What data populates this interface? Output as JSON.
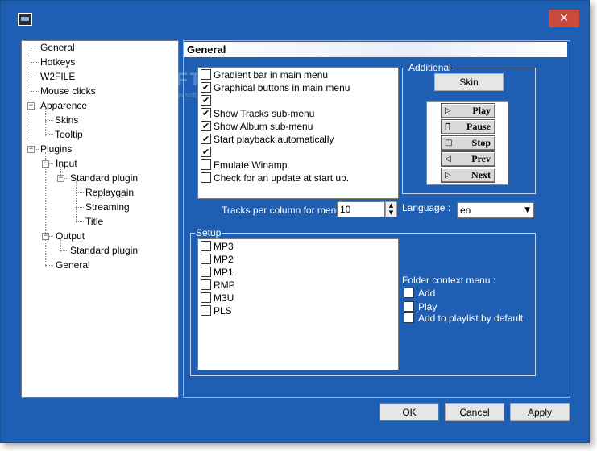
{
  "window": {
    "close_glyph": "✕"
  },
  "tree": {
    "items": [
      {
        "label": "General"
      },
      {
        "label": "Hotkeys"
      },
      {
        "label": "W2FILE"
      },
      {
        "label": "Mouse clicks"
      },
      {
        "label": "Apparence"
      },
      {
        "label": "Skins"
      },
      {
        "label": "Tooltip"
      },
      {
        "label": "Plugins"
      },
      {
        "label": "Input"
      },
      {
        "label": "Standard plugin"
      },
      {
        "label": "Replaygain"
      },
      {
        "label": "Streaming"
      },
      {
        "label": "Title"
      },
      {
        "label": "Output"
      },
      {
        "label": "Standard plugin"
      },
      {
        "label": "General"
      }
    ],
    "expander_glyph": "−"
  },
  "panel": {
    "title": "General"
  },
  "options": [
    {
      "label": "Gradient bar in main menu",
      "checked": false
    },
    {
      "label": "Graphical buttons in main menu",
      "checked": true
    },
    {
      "label": "",
      "checked": true
    },
    {
      "label": "Show Tracks sub-menu",
      "checked": true
    },
    {
      "label": "Show Album sub-menu",
      "checked": true
    },
    {
      "label": "Start playback automatically",
      "checked": true
    },
    {
      "label": "",
      "checked": true
    },
    {
      "label": "Emulate Winamp",
      "checked": false
    },
    {
      "label": "Check for an update at start up.",
      "checked": false
    }
  ],
  "check_glyph": "✔",
  "additional": {
    "group_label": "Additional",
    "skin_button": "Skin",
    "skin_preview": [
      {
        "label": "Play",
        "icon": "play-icon",
        "symbol": "▷"
      },
      {
        "label": "Pause",
        "icon": "pause-icon",
        "symbol": "∏"
      },
      {
        "label": "Stop",
        "icon": "stop-icon",
        "symbol": "□"
      },
      {
        "label": "Prev",
        "icon": "prev-icon",
        "symbol": "◁"
      },
      {
        "label": "Next",
        "icon": "next-icon",
        "symbol": "▷"
      }
    ]
  },
  "tracks_per_column": {
    "label": "Tracks per column for menus :",
    "value": "10",
    "spin_up": "▲",
    "spin_down": "▼"
  },
  "language": {
    "label": "Language :",
    "value": "en",
    "arrow": "▼"
  },
  "setup": {
    "group_label": "Setup",
    "formats": [
      {
        "label": "MP3",
        "checked": false
      },
      {
        "label": "MP2",
        "checked": false
      },
      {
        "label": "MP1",
        "checked": false
      },
      {
        "label": "RMP",
        "checked": false
      },
      {
        "label": "M3U",
        "checked": false
      },
      {
        "label": "PLS",
        "checked": false
      }
    ],
    "folder_context_label": "Folder context menu :",
    "folder_options": [
      {
        "label": "Add",
        "checked": false
      },
      {
        "label": "Play",
        "checked": false
      },
      {
        "label": "Add to playlist by default",
        "checked": false
      }
    ]
  },
  "buttons": {
    "ok": "OK",
    "cancel": "Cancel",
    "apply": "Apply"
  },
  "watermark": {
    "main": "SOFTP",
    "sub": "www.softpedia.com"
  }
}
